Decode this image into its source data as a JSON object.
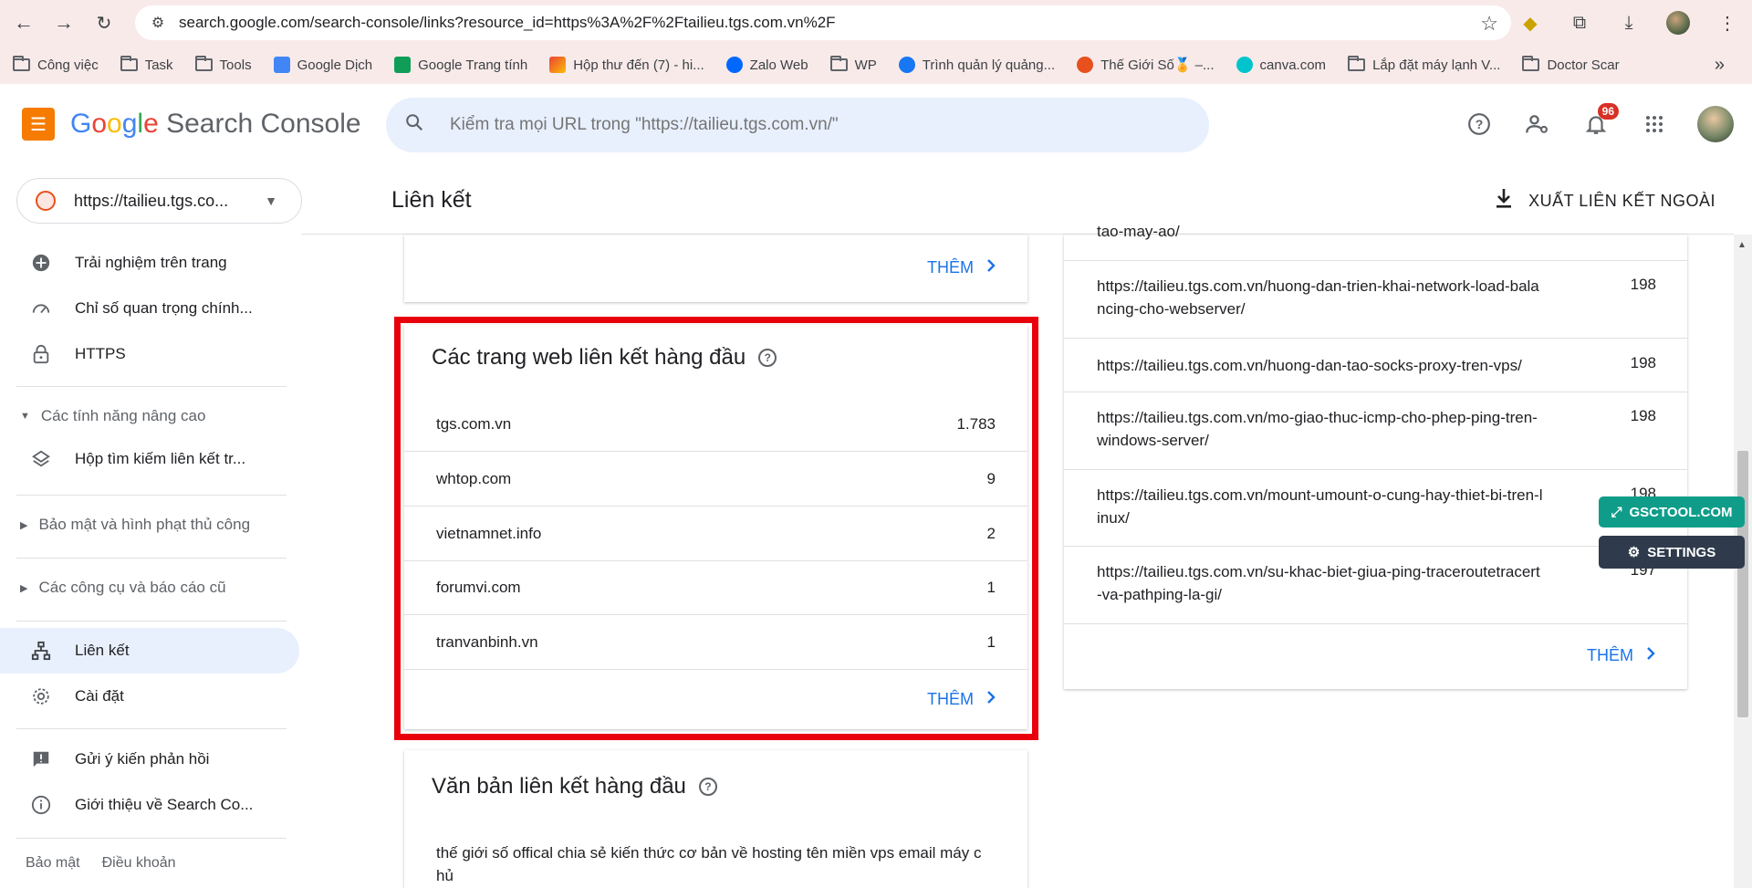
{
  "browser": {
    "url": "search.google.com/search-console/links?resource_id=https%3A%2F%2Ftailieu.tgs.com.vn%2F",
    "bookmarks": [
      "Công việc",
      "Task",
      "Tools",
      "Google Dịch",
      "Google Trang tính",
      "Hộp thư đến (7) - hi...",
      "Zalo Web",
      "WP",
      "Trình quản lý quảng...",
      "Thế Giới Số🏅 –...",
      "canva.com",
      "Lắp đặt máy lạnh V...",
      "Doctor Scar"
    ],
    "more": "»"
  },
  "header": {
    "logo_google": [
      "G",
      "o",
      "o",
      "g",
      "l",
      "e"
    ],
    "logo_product": "Search Console",
    "search_placeholder": "Kiểm tra mọi URL trong \"https://tailieu.tgs.com.vn/\"",
    "notifications_count": "96"
  },
  "sidebar": {
    "property": "https://tailieu.tgs.co...",
    "items": [
      {
        "label": "Trải nghiệm trên trang"
      },
      {
        "label": "Chỉ số quan trọng chính..."
      },
      {
        "label": "HTTPS"
      }
    ],
    "section_advanced": "Các tính năng nâng cao",
    "sitelinks": "Hộp tìm kiếm liên kết tr...",
    "section_security": "Bảo mật và hình phạt thủ công",
    "section_legacy": "Các công cụ và báo cáo cũ",
    "links": "Liên kết",
    "settings": "Cài đặt",
    "feedback": "Gửi ý kiến phản hồi",
    "about": "Giới thiệu về Search Co...",
    "footer_privacy": "Bảo mật",
    "footer_terms": "Điều khoản"
  },
  "main": {
    "title": "Liên kết",
    "export_label": "XUẤT LIÊN KẾT NGOÀI",
    "more_label": "THÊM",
    "top_sites": {
      "title": "Các trang web liên kết hàng đầu",
      "rows": [
        {
          "site": "tgs.com.vn",
          "count": "1.783"
        },
        {
          "site": "whtop.com",
          "count": "9"
        },
        {
          "site": "vietnamnet.info",
          "count": "2"
        },
        {
          "site": "forumvi.com",
          "count": "1"
        },
        {
          "site": "tranvanbinh.vn",
          "count": "1"
        }
      ]
    },
    "top_text": {
      "title": "Văn bản liên kết hàng đầu",
      "first": "thế giới số offical chia sẻ kiến thức cơ bản về hosting tên miền vps email máy c\nhủ"
    },
    "linked_pages": {
      "partial_top": "tao-may-ao/",
      "rows": [
        {
          "url": "https://tailieu.tgs.com.vn/huong-dan-trien-khai-network-load-bala\nncing-cho-webserver/",
          "count": "198"
        },
        {
          "url": "https://tailieu.tgs.com.vn/huong-dan-tao-socks-proxy-tren-vps/",
          "count": "198"
        },
        {
          "url": "https://tailieu.tgs.com.vn/mo-giao-thuc-icmp-cho-phep-ping-tren-\nwindows-server/",
          "count": "198"
        },
        {
          "url": "https://tailieu.tgs.com.vn/mount-umount-o-cung-hay-thiet-bi-tren-l\ninux/",
          "count": "198"
        },
        {
          "url": "https://tailieu.tgs.com.vn/su-khac-biet-giua-ping-traceroutetracert\n-va-pathping-la-gi/",
          "count": "197"
        }
      ]
    }
  },
  "extension": {
    "gsctool": "GSCTOOL.COM",
    "settings": "SETTINGS"
  }
}
